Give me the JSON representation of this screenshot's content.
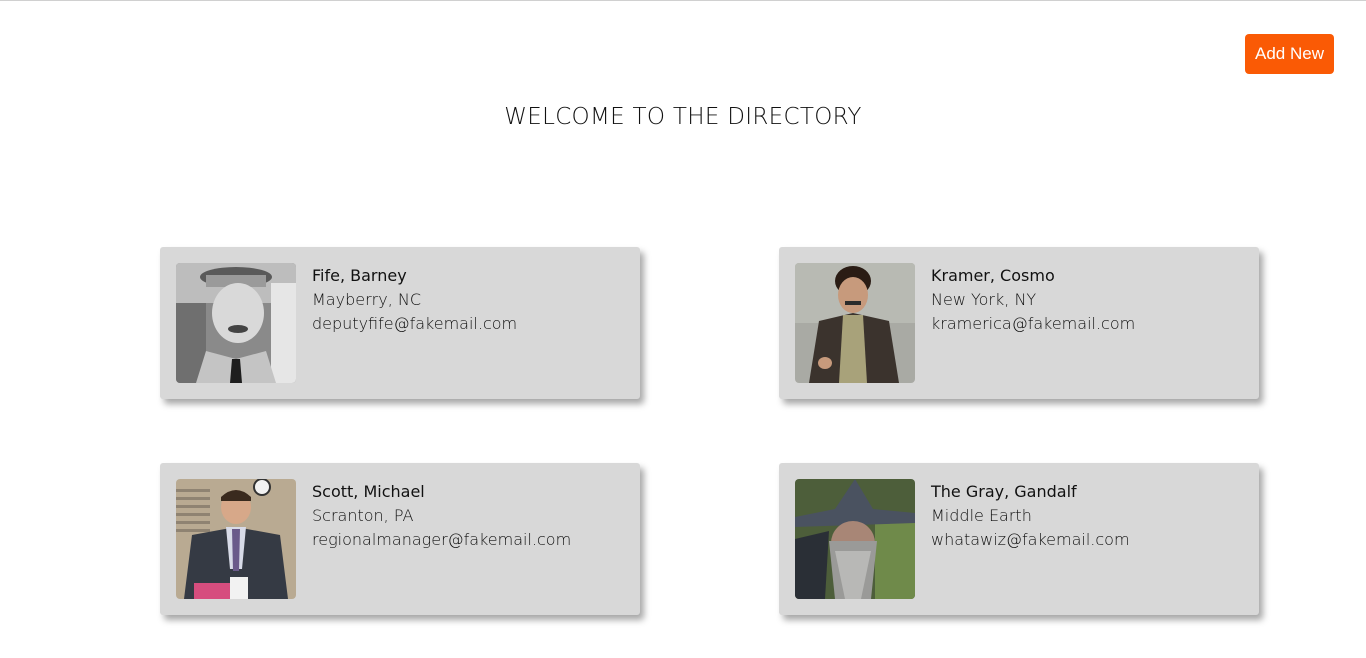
{
  "header": {
    "add_label": "Add New",
    "title": "WELCOME TO THE DIRECTORY"
  },
  "colors": {
    "accent": "#fa5a05",
    "card_bg": "#d8d8d8"
  },
  "contacts": [
    {
      "name": "Fife, Barney",
      "location": "Mayberry, NC",
      "email": "deputyfife@fakemail.com",
      "photo": "barney-fife-photo"
    },
    {
      "name": "Kramer, Cosmo",
      "location": "New York, NY",
      "email": "kramerica@fakemail.com",
      "photo": "cosmo-kramer-photo"
    },
    {
      "name": "Scott, Michael",
      "location": "Scranton, PA",
      "email": "regionalmanager@fakemail.com",
      "photo": "michael-scott-photo"
    },
    {
      "name": "The Gray, Gandalf",
      "location": "Middle Earth",
      "email": "whatawiz@fakemail.com",
      "photo": "gandalf-photo"
    }
  ]
}
